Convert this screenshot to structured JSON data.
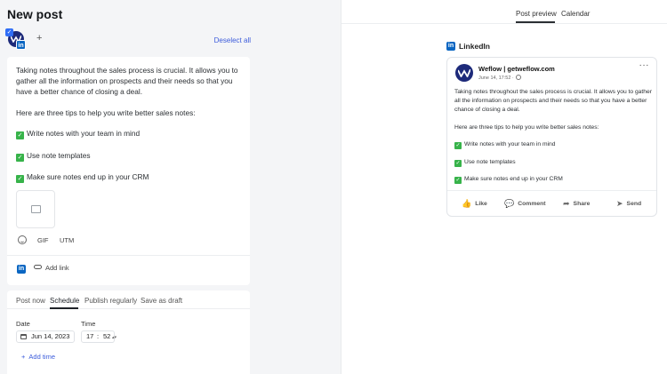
{
  "page": {
    "title": "New post"
  },
  "accounts": {
    "add_symbol": "+",
    "deselect_all": "Deselect all",
    "check_mark": "✓",
    "linkedin_mark": "in"
  },
  "editor": {
    "paragraphs": [
      "Taking notes throughout the sales process is crucial. It allows you to gather all the information on prospects and their needs so that you have a better chance of closing a deal.",
      "Here are three tips to help you write better sales notes:"
    ],
    "tips": [
      "Write notes with your team in mind",
      "Use note templates",
      "Make sure notes end up in your CRM"
    ],
    "tip_check": "✓",
    "tools": {
      "gif": "GIF",
      "utm": "UTM"
    },
    "add_link": "Add link",
    "linkedin_mark": "in"
  },
  "schedule": {
    "tabs": [
      "Post now",
      "Schedule",
      "Publish regularly",
      "Save as draft"
    ],
    "active_tab": "Schedule",
    "date_label": "Date",
    "date_value": "Jun 14, 2023",
    "time_label": "Time",
    "time_hour": "17",
    "time_separator": ":",
    "time_minute": "52",
    "time_caret": "▴▾",
    "add_time_plus": "+",
    "add_time": "Add time"
  },
  "preview": {
    "tabs": [
      "Post preview",
      "Calendar"
    ],
    "active_tab": "Post preview",
    "network": "LinkedIn",
    "network_mark": "in",
    "author": "Weflow | getweflow.com",
    "meta": "June 14, 17:52 ·",
    "more": "···",
    "actions": [
      {
        "label": "Like",
        "icon": "👍"
      },
      {
        "label": "Comment",
        "icon": "💬"
      },
      {
        "label": "Share",
        "icon": "➦"
      },
      {
        "label": "Send",
        "icon": "➤"
      }
    ]
  },
  "colors": {
    "accent": "#3b5bdb",
    "linkedin": "#0a66c2",
    "check_green": "#37b34a",
    "brand_navy": "#1d2a7a"
  }
}
